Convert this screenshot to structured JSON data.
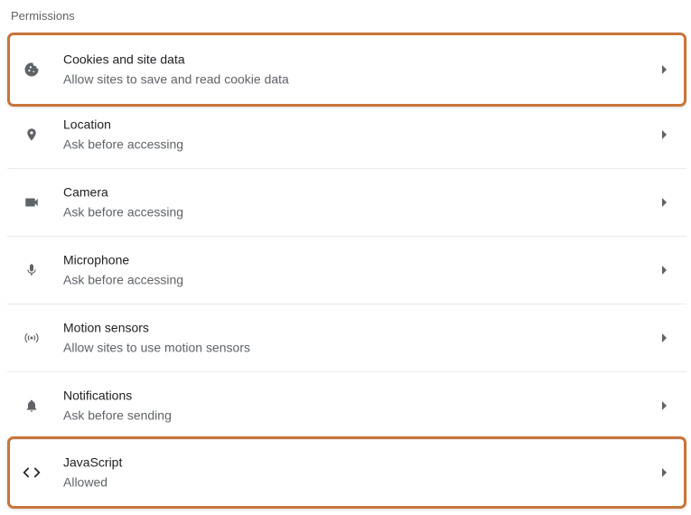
{
  "section": {
    "title": "Permissions"
  },
  "permissions": [
    {
      "label": "Cookies and site data",
      "sublabel": "Allow sites to save and read cookie data",
      "icon": "cookie-icon"
    },
    {
      "label": "Location",
      "sublabel": "Ask before accessing",
      "icon": "location-pin-icon"
    },
    {
      "label": "Camera",
      "sublabel": "Ask before accessing",
      "icon": "camera-icon"
    },
    {
      "label": "Microphone",
      "sublabel": "Ask before accessing",
      "icon": "microphone-icon"
    },
    {
      "label": "Motion sensors",
      "sublabel": "Allow sites to use motion sensors",
      "icon": "motion-sensors-icon"
    },
    {
      "label": "Notifications",
      "sublabel": "Ask before sending",
      "icon": "bell-icon"
    },
    {
      "label": "JavaScript",
      "sublabel": "Allowed",
      "icon": "code-brackets-icon"
    }
  ],
  "colors": {
    "highlight_border": "#c8753a",
    "icon": "#5f6368",
    "divider": "#e8eaed"
  }
}
